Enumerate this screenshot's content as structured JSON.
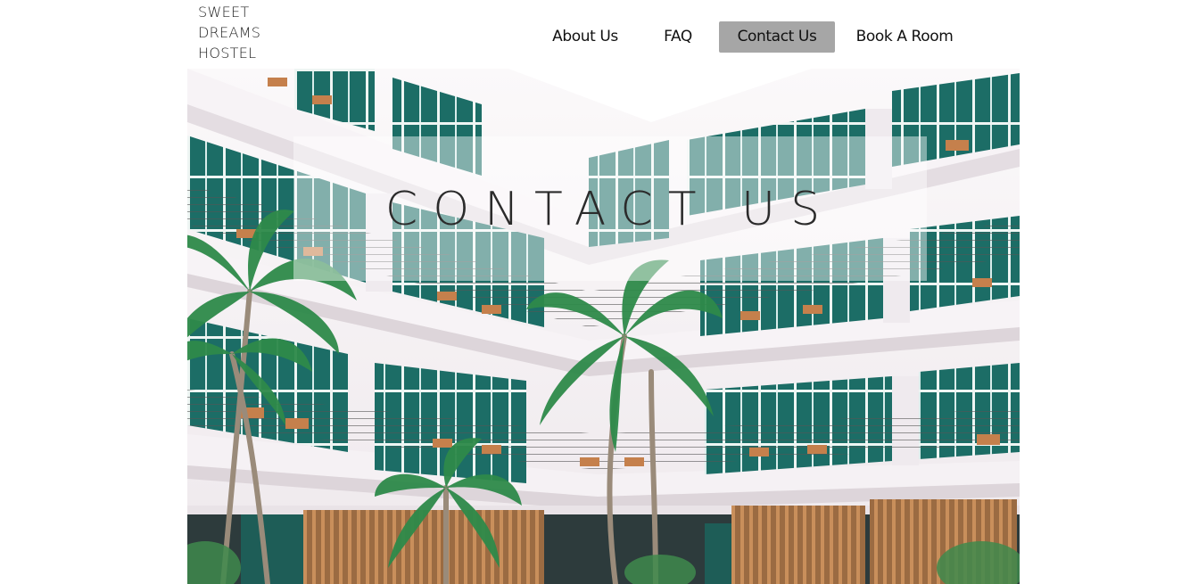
{
  "logo": {
    "line1": "SWEET",
    "line2": "DREAMS",
    "line3": "HOSTEL"
  },
  "nav": {
    "about": "About Us",
    "faq": "FAQ",
    "contact": "Contact Us",
    "book": "Book A Room",
    "active_color": "#a6a6a6"
  },
  "hero": {
    "title": "CONTACT US",
    "image": "hotel-courtyard-photo"
  },
  "colors": {
    "building": "#f4f0f3",
    "window_teal": "#1f7a70",
    "palm": "#2f8f4e",
    "wood": "#b07a4a"
  }
}
